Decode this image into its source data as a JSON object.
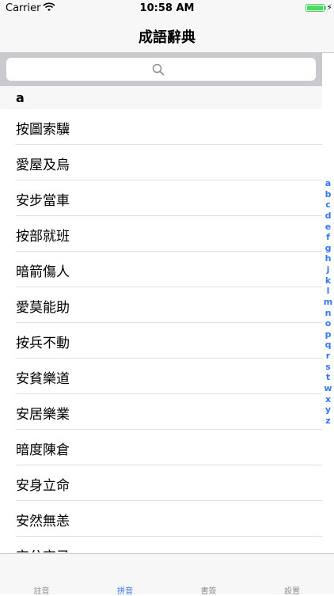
{
  "status": {
    "carrier": "Carrier",
    "time": "10:58 AM",
    "battery_level": 1.0
  },
  "nav": {
    "title": "成語辭典"
  },
  "search": {
    "placeholder": ""
  },
  "section": {
    "header": "a"
  },
  "items": [
    "按圖索驥",
    "愛屋及烏",
    "安步當車",
    "按部就班",
    "暗箭傷人",
    "愛莫能助",
    "按兵不動",
    "安貧樂道",
    "安居樂業",
    "暗度陳倉",
    "安身立命",
    "安然無恙",
    "安分守己"
  ],
  "index_letters": [
    "a",
    "b",
    "c",
    "d",
    "e",
    "f",
    "g",
    "h",
    "j",
    "k",
    "l",
    "m",
    "n",
    "o",
    "p",
    "q",
    "r",
    "s",
    "t",
    "w",
    "x",
    "y",
    "z"
  ],
  "tabs": [
    {
      "label": "註音",
      "active": false
    },
    {
      "label": "拼音",
      "active": true
    },
    {
      "label": "書簽",
      "active": false
    },
    {
      "label": "設置",
      "active": false
    }
  ],
  "colors": {
    "accent": "#3478f6",
    "battery": "#4cd964"
  }
}
